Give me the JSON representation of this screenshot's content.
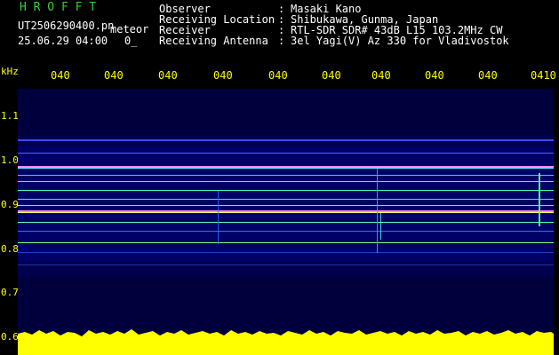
{
  "header": {
    "brand": "H R O F F T",
    "filename": "UT2506290400.pn",
    "meteor_label": "meteor",
    "datetime": "25.06.29 04:00",
    "count": "0_"
  },
  "info": [
    {
      "label": "Observer",
      "sep": ":",
      "value": "Masaki Kano"
    },
    {
      "label": "Receiving Location",
      "sep": ":",
      "value": "Shibukawa, Gunma, Japan"
    },
    {
      "label": "Receiver",
      "sep": ":",
      "value": "RTL-SDR SDR# 43dB L15 103.2MHz CW"
    },
    {
      "label": "Receiving Antenna",
      "sep": ":",
      "value": "3el Yagi(V) Az 330 for Vladivostok"
    }
  ],
  "axes": {
    "unit": "kHz",
    "y_ticks": [
      "1.1",
      "1.0",
      "0.9",
      "0.8",
      "0.7",
      "0.6"
    ],
    "x_ticks": [
      "040",
      "040",
      "040",
      "040",
      "040",
      "040",
      "040",
      "040",
      "040",
      "0410"
    ]
  },
  "colors": {
    "background": "#000000",
    "spectrogram_bg": "#00003c",
    "brand": "#2fd02f",
    "text": "#ffffff",
    "ticks": "#ffff00",
    "power_trace": "#ffff00"
  }
}
